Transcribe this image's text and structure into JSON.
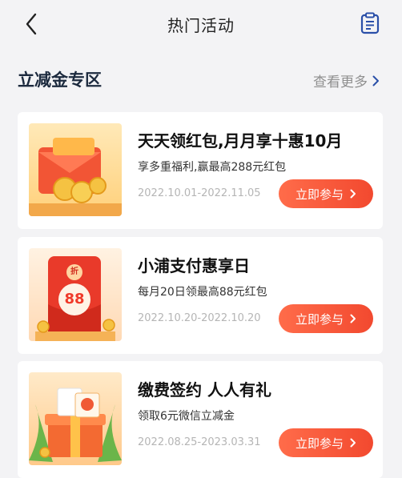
{
  "nav": {
    "title": "热门活动"
  },
  "section": {
    "title": "立减金专区",
    "more_label": "查看更多"
  },
  "cards": [
    {
      "title": "天天领红包,月月享十惠10月",
      "desc": "享多重福利,赢最高288元红包",
      "date": "2022.10.01-2022.11.05",
      "button": "立即参与"
    },
    {
      "title": "小浦支付惠享日",
      "desc": "每月20日领最高88元红包",
      "date": "2022.10.20-2022.10.20",
      "button": "立即参与",
      "badge_char": "折",
      "badge_amount": "88"
    },
    {
      "title": "缴费签约 人人有礼",
      "desc": "领取6元微信立减金",
      "date": "2022.08.25-2023.03.31",
      "button": "立即参与"
    }
  ],
  "colors": {
    "accent": "#f2492f",
    "title_dark": "#1c2a3e",
    "icon_blue": "#2a4fa8"
  },
  "icons": [
    "back-arrow-icon",
    "clipboard-icon",
    "chevron-right-icon"
  ]
}
